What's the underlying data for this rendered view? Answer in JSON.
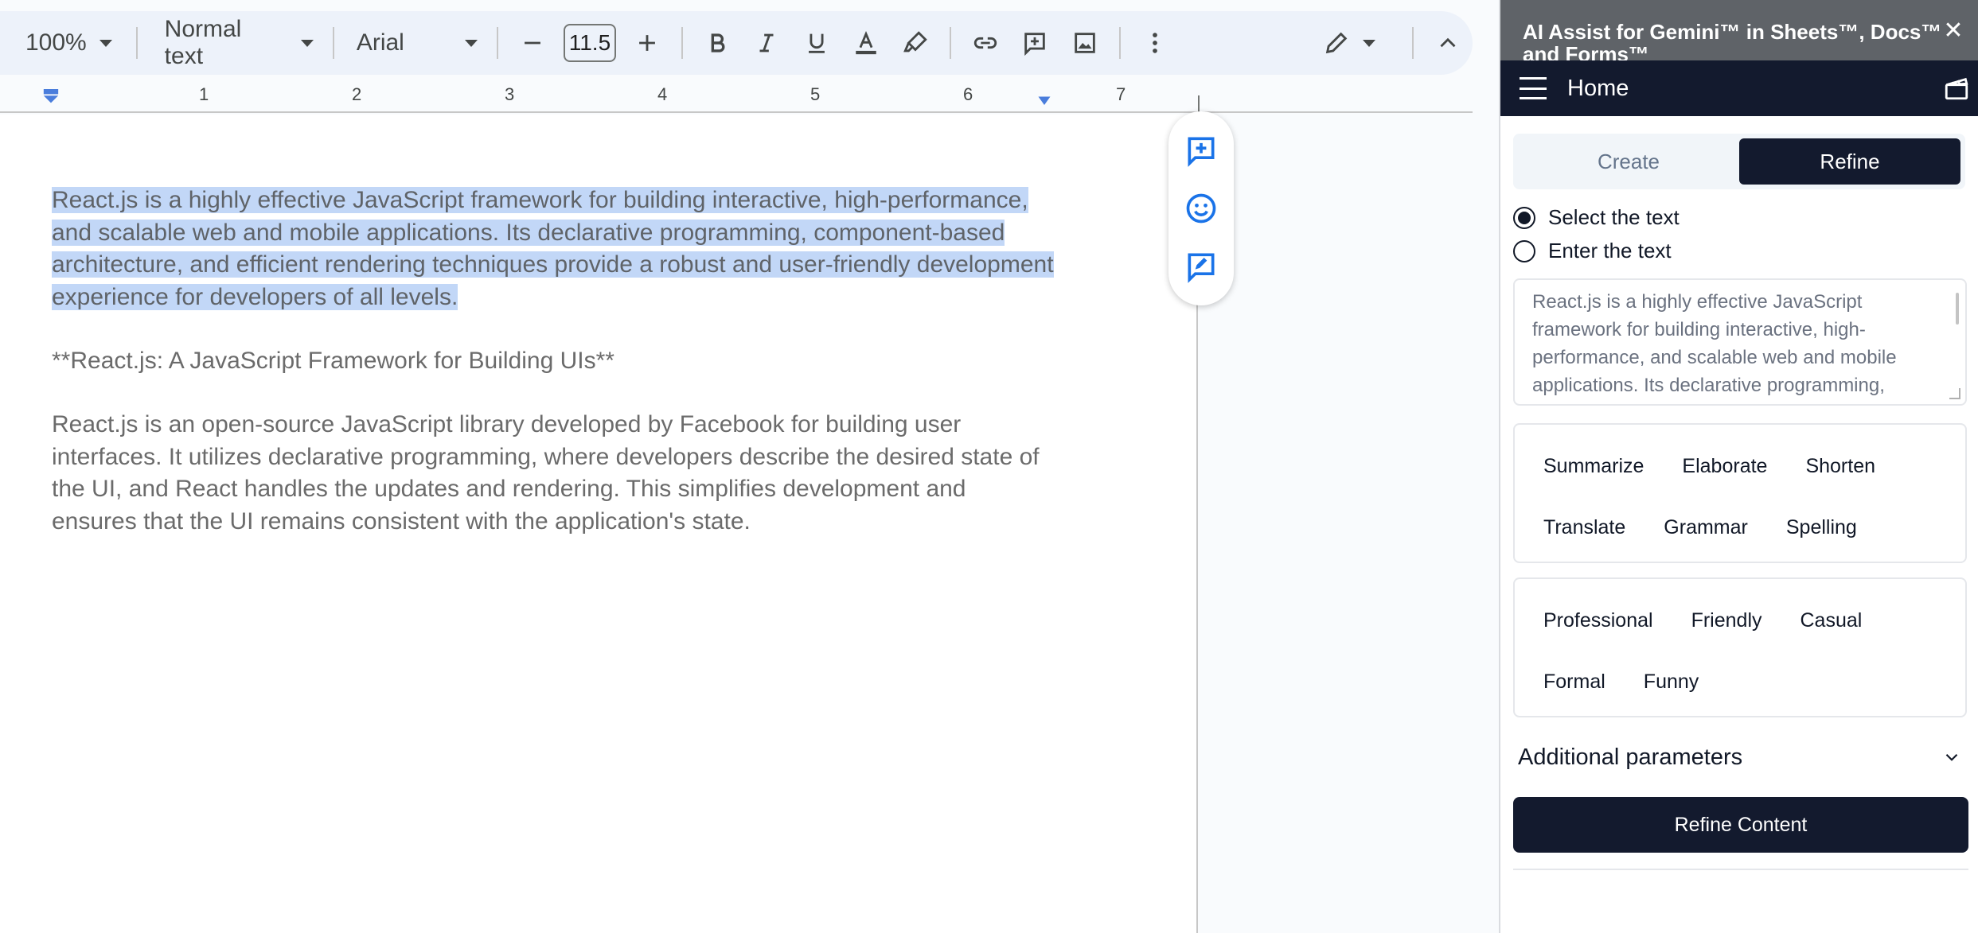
{
  "toolbar": {
    "zoom": "100%",
    "style": "Normal text",
    "font": "Arial",
    "font_size": "11.5",
    "icons": [
      "minus-icon",
      "plus-icon",
      "bold-icon",
      "italic-icon",
      "underline-icon",
      "text-color-icon",
      "highlighter-icon",
      "link-icon",
      "add-comment-icon",
      "insert-image-icon",
      "more-vert-icon",
      "pencil-icon",
      "chevron-up-icon"
    ]
  },
  "ruler": {
    "numbers": [
      "1",
      "2",
      "3",
      "4",
      "5",
      "6",
      "7"
    ]
  },
  "document": {
    "paragraph_1": "React.js is a highly effective JavaScript framework for building interactive, high-performance, and scalable web and mobile applications. Its declarative programming, component-based architecture, and efficient rendering techniques provide a robust and user-friendly development experience for developers of all levels.",
    "paragraph_2": "**React.js: A JavaScript Framework for Building UIs**",
    "paragraph_3": "React.js is an open-source JavaScript library developed by Facebook for building user interfaces. It utilizes declarative programming, where developers describe the desired state of the UI, and React handles the updates and rendering. This simplifies development and ensures that the UI remains consistent with the application's state."
  },
  "side_panel": {
    "addon_title": "AI Assist for Gemini™ in Sheets™, Docs™ and Forms™",
    "header_title": "Home",
    "tabs": [
      {
        "label": "Create",
        "active": false
      },
      {
        "label": "Refine",
        "active": true
      }
    ],
    "radio_options": [
      {
        "label": "Select the text",
        "checked": true
      },
      {
        "label": "Enter the text",
        "checked": false
      }
    ],
    "text_preview": "React.js is a highly effective JavaScript framework for building interactive, high-performance, and scalable web and mobile applications. Its declarative programming, component-based architecture and",
    "actions": [
      "Summarize",
      "Elaborate",
      "Shorten",
      "Translate",
      "Grammar",
      "Spelling"
    ],
    "tones": [
      "Professional",
      "Friendly",
      "Casual",
      "Formal",
      "Funny"
    ],
    "additional_parameters": "Additional parameters",
    "refine_button": "Refine Content"
  },
  "colors": {
    "toolbar_bg": "#edf2fa",
    "selection": "#c2d7f7",
    "panel_dark": "#131a2e",
    "addon_bar": "#5f6368"
  }
}
